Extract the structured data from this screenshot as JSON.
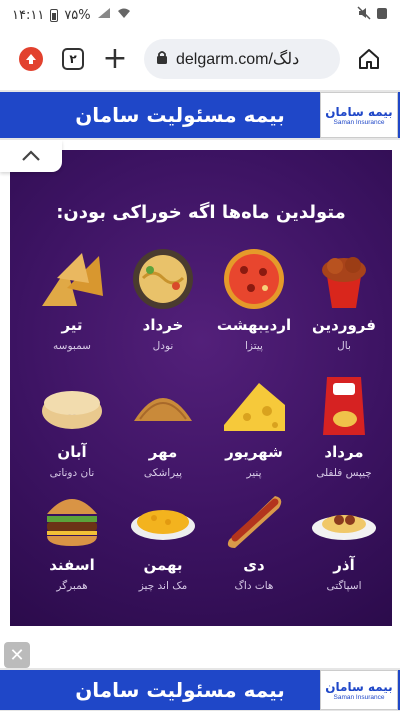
{
  "status_bar": {
    "time": "۱۴:۱۱",
    "battery": "۷۵%"
  },
  "browser": {
    "url": "delgarm.com/دلگ",
    "tab_count": "۲"
  },
  "ad": {
    "text": "بیمه مسئولیت سامان",
    "logo_fa": "بیمه سامان",
    "logo_en": "Saman Insurance"
  },
  "poster": {
    "title": "متولدین ماه‌ها اگه خوراکی بودن:",
    "items": [
      {
        "month": "فروردین",
        "food": "بال"
      },
      {
        "month": "اردیبهشت",
        "food": "پیتزا"
      },
      {
        "month": "خرداد",
        "food": "نودل"
      },
      {
        "month": "تیر",
        "food": "سمبوسه"
      },
      {
        "month": "مرداد",
        "food": "چیپس فلفلی"
      },
      {
        "month": "شهریور",
        "food": "پنیر"
      },
      {
        "month": "مهر",
        "food": "پیراشکی"
      },
      {
        "month": "آبان",
        "food": "نان دوناتی"
      },
      {
        "month": "آذر",
        "food": "اسپاگتی"
      },
      {
        "month": "دی",
        "food": "هات داگ"
      },
      {
        "month": "بهمن",
        "food": "مک اند چیز"
      },
      {
        "month": "اسفند",
        "food": "همبرگر"
      }
    ]
  },
  "colors": {
    "ad_blue": "#1f47c8",
    "poster_purple": "#3c1362"
  },
  "icons": [
    "home-icon",
    "lock-icon",
    "plus-icon",
    "tabs-icon",
    "download-icon",
    "chevron-up-icon",
    "close-icon"
  ]
}
